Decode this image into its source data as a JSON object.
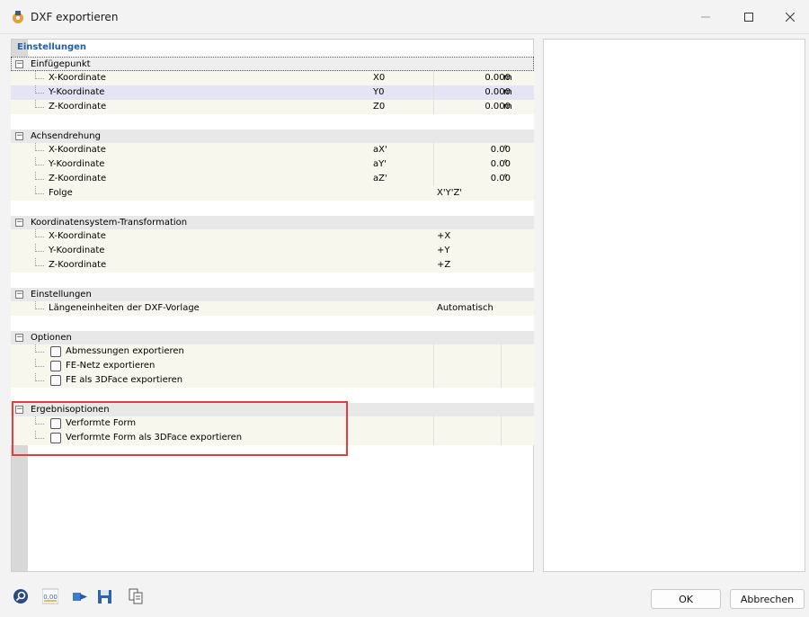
{
  "window": {
    "title": "DXF exportieren"
  },
  "panel_heading": "Einstellungen",
  "groups": {
    "einfuegepunkt": {
      "label": "Einfügepunkt",
      "rows": [
        {
          "label": "X-Koordinate",
          "symbol": "X0",
          "value": "0.000",
          "unit": "m"
        },
        {
          "label": "Y-Koordinate",
          "symbol": "Y0",
          "value": "0.000",
          "unit": "m"
        },
        {
          "label": "Z-Koordinate",
          "symbol": "Z0",
          "value": "0.000",
          "unit": "m"
        }
      ]
    },
    "achsendrehung": {
      "label": "Achsendrehung",
      "rows": [
        {
          "label": "X-Koordinate",
          "symbol": "aX'",
          "value": "0.00",
          "unit": "°"
        },
        {
          "label": "Y-Koordinate",
          "symbol": "aY'",
          "value": "0.00",
          "unit": "°"
        },
        {
          "label": "Z-Koordinate",
          "symbol": "aZ'",
          "value": "0.00",
          "unit": "°"
        },
        {
          "label": "Folge",
          "value": "X'Y'Z'"
        }
      ]
    },
    "transformation": {
      "label": "Koordinatensystem-Transformation",
      "rows": [
        {
          "label": "X-Koordinate",
          "value": "+X"
        },
        {
          "label": "Y-Koordinate",
          "value": "+Y"
        },
        {
          "label": "Z-Koordinate",
          "value": "+Z"
        }
      ]
    },
    "einstellungen": {
      "label": "Einstellungen",
      "rows": [
        {
          "label": "Längeneinheiten der DXF-Vorlage",
          "value": "Automatisch"
        }
      ]
    },
    "optionen": {
      "label": "Optionen",
      "rows": [
        {
          "label": "Abmessungen exportieren",
          "checked": false
        },
        {
          "label": "FE-Netz exportieren",
          "checked": false
        },
        {
          "label": "FE als 3DFace exportieren",
          "checked": false
        }
      ]
    },
    "ergebnisoptionen": {
      "label": "Ergebnisoptionen",
      "rows": [
        {
          "label": "Verformte Form",
          "checked": false
        },
        {
          "label": "Verformte Form als 3DFace exportieren",
          "checked": false
        }
      ]
    }
  },
  "toolbar_icons": [
    "search-icon",
    "units-icon",
    "transfer-icon",
    "save-icon",
    "copy-icon"
  ],
  "units_icon_text": "0.00",
  "buttons": {
    "ok": "OK",
    "cancel": "Abbrechen"
  },
  "colors": {
    "highlight": "#e0403d",
    "heading": "#1f5fa8",
    "selected_row": "#e4e4f4"
  }
}
